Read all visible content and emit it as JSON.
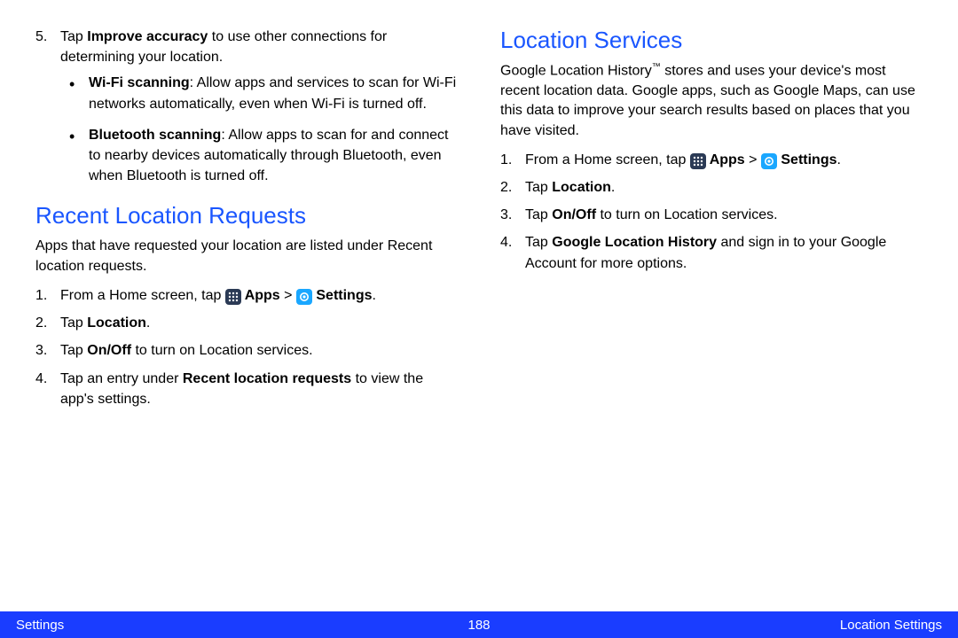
{
  "left": {
    "step5_prefix": "Tap ",
    "step5_bold": "Improve accuracy",
    "step5_suffix": " to use other connections for determining your location.",
    "wifi_label": "Wi-Fi scanning",
    "wifi_text": ": Allow apps and services to scan for Wi-Fi networks automatically, even when Wi-Fi is turned off.",
    "bt_label": "Bluetooth scanning",
    "bt_text": ": Allow apps to scan for and connect to nearby devices automatically through Bluetooth, even when Bluetooth is turned off.",
    "heading": "Recent Location Requests",
    "intro": "Apps that have requested your location are listed under Recent location requests.",
    "s1_a": "From a Home screen, tap ",
    "s1_apps": " Apps",
    "s1_gt": " > ",
    "s1_settings": " Settings",
    "s1_end": ".",
    "s2_a": "Tap ",
    "s2_b": "Location",
    "s2_c": ".",
    "s3_a": "Tap ",
    "s3_b": "On/Off",
    "s3_c": " to turn on Location services.",
    "s4_a": "Tap an entry under ",
    "s4_b": "Recent location requests",
    "s4_c": " to view the app's settings."
  },
  "right": {
    "heading": "Location Services",
    "intro_a": "Google Location History",
    "intro_tm": "™",
    "intro_b": " stores and uses your device's most recent location data. Google apps, such as Google Maps, can use this data to improve your search results based on places that you have visited.",
    "s1_a": "From a Home screen, tap ",
    "s1_apps": " Apps",
    "s1_gt": " > ",
    "s1_settings": " Settings",
    "s1_end": ".",
    "s2_a": "Tap ",
    "s2_b": "Location",
    "s2_c": ".",
    "s3_a": "Tap ",
    "s3_b": "On/Off",
    "s3_c": " to turn on Location services.",
    "s4_a": "Tap ",
    "s4_b": "Google Location History",
    "s4_c": " and sign in to your Google Account for more options."
  },
  "footer": {
    "left": "Settings",
    "center": "188",
    "right": "Location Settings"
  },
  "nums": {
    "n1": "1.",
    "n2": "2.",
    "n3": "3.",
    "n4": "4.",
    "n5": "5."
  }
}
